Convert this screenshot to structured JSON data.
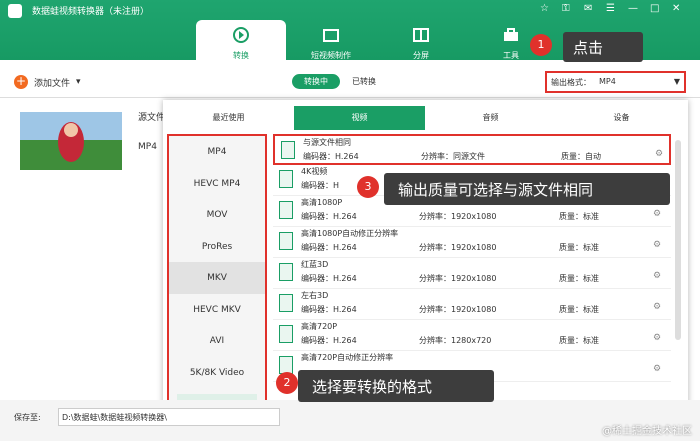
{
  "app": {
    "title": "数据蛙视频转换器（未注册）"
  },
  "window_controls": [
    "☆",
    "⚿",
    "✉",
    "☰",
    "—",
    "□",
    "✕"
  ],
  "nav": {
    "items": [
      {
        "label": "转换"
      },
      {
        "label": "短视频制作"
      },
      {
        "label": "分屏"
      },
      {
        "label": "工具"
      }
    ]
  },
  "toolbar": {
    "add_file": "添加文件",
    "add_dropdown": "▾",
    "converting": "转换中",
    "converted": "已转换"
  },
  "output": {
    "label": "输出格式：",
    "value": "MP4",
    "arrow": "▼"
  },
  "file": {
    "source_label": "源文件",
    "format": "MP4"
  },
  "tabs": [
    "最近使用",
    "视频",
    "音频",
    "设备"
  ],
  "formats": [
    "MP4",
    "HEVC MP4",
    "MOV",
    "ProRes",
    "MKV",
    "HEVC MKV",
    "AVI",
    "5K/8K Video"
  ],
  "format_search": "🔍 搜索",
  "presets": [
    {
      "name": "与源文件相同",
      "codec": "编码器：H.264",
      "res": "分辨率：同源文件",
      "qual": "质量：自动"
    },
    {
      "name": "4K视频",
      "codec": "编码器：H",
      "res": "",
      "qual": ""
    },
    {
      "name": "高清1080P",
      "codec": "编码器：H.264",
      "res": "分辨率：1920x1080",
      "qual": "质量：标准"
    },
    {
      "name": "高清1080P自动修正分辨率",
      "codec": "编码器：H.264",
      "res": "分辨率：1920x1080",
      "qual": "质量：标准"
    },
    {
      "name": "红蓝3D",
      "codec": "编码器：H.264",
      "res": "分辨率：1920x1080",
      "qual": "质量：标准"
    },
    {
      "name": "左右3D",
      "codec": "编码器：H.264",
      "res": "分辨率：1920x1080",
      "qual": "质量：标准"
    },
    {
      "name": "高清720P",
      "codec": "编码器：H.264",
      "res": "分辨率：1280x720",
      "qual": "质量：标准"
    },
    {
      "name": "高清720P自动修正分辨率",
      "codec": "",
      "res": "",
      "qual": ""
    }
  ],
  "save": {
    "label": "保存至:",
    "path": "D:\\数据蛙\\数据蛙视频转换器\\"
  },
  "callouts": [
    {
      "num": "1",
      "text": "点击"
    },
    {
      "num": "2",
      "text": "选择要转换的格式"
    },
    {
      "num": "3",
      "text": "输出质量可选择与源文件相同"
    }
  ],
  "watermark": "@稀土掘金技术社区",
  "colors": {
    "brand": "#1a9e65",
    "highlight": "#e0312b",
    "accent": "#f26a21"
  }
}
